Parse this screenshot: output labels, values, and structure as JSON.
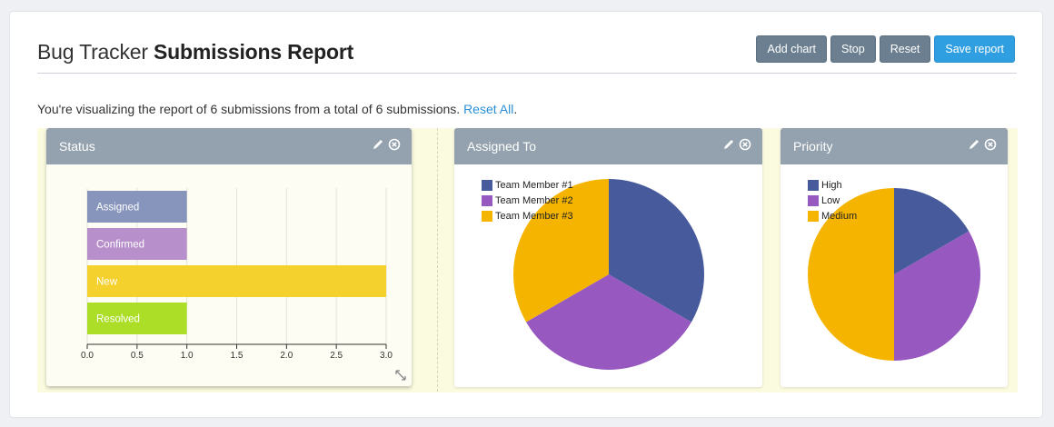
{
  "header": {
    "title_prefix": "Bug Tracker",
    "title_bold": "Submissions Report"
  },
  "toolbar": {
    "add_chart": "Add chart",
    "stop": "Stop",
    "reset": "Reset",
    "save_report": "Save report"
  },
  "info": {
    "text": "You're visualizing the report of 6 submissions from a total of 6 submissions.",
    "reset_all": "Reset All",
    "period": "."
  },
  "colors": {
    "blue": "#465a9c",
    "purple": "#9758c0",
    "yellow": "#f4b400",
    "bar_assigned": "#8795bc",
    "bar_confirmed": "#b68fcb",
    "bar_new": "#f5d12e",
    "bar_resolved": "#acde28"
  },
  "panels": {
    "status": {
      "title": "Status"
    },
    "assigned": {
      "title": "Assigned To"
    },
    "priority": {
      "title": "Priority"
    }
  },
  "chart_data": [
    {
      "type": "bar",
      "orientation": "horizontal",
      "title": "Status",
      "categories": [
        "Assigned",
        "Confirmed",
        "New",
        "Resolved"
      ],
      "values": [
        1,
        1,
        3,
        1
      ],
      "xlim": [
        0,
        3
      ],
      "ticks": [
        "0.0",
        "0.5",
        "1.0",
        "1.5",
        "2.0",
        "2.5",
        "3.0"
      ],
      "grid": true
    },
    {
      "type": "pie",
      "title": "Assigned To",
      "labels": [
        "Team Member #1",
        "Team Member #2",
        "Team Member #3"
      ],
      "values": [
        2,
        2,
        2
      ],
      "legend": "top-left"
    },
    {
      "type": "pie",
      "title": "Priority",
      "labels": [
        "High",
        "Low",
        "Medium"
      ],
      "values": [
        1,
        2,
        3
      ],
      "legend": "top-left"
    }
  ]
}
